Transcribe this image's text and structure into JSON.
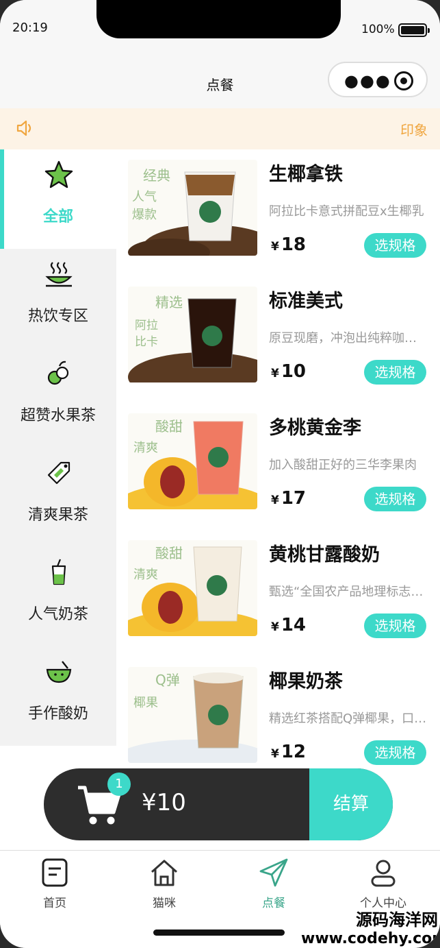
{
  "status_bar": {
    "time": "20:19",
    "battery": "100%"
  },
  "nav": {
    "title": "点餐",
    "capsule_menu_icon": "more-dots-icon",
    "capsule_close_icon": "target-icon"
  },
  "notice": {
    "icon": "speaker-icon",
    "text": "印象"
  },
  "sidebar": {
    "items": [
      {
        "label": "全部",
        "icon": "star-icon",
        "active": true
      },
      {
        "label": "热饮专区",
        "icon": "hot-drink-icon",
        "active": false
      },
      {
        "label": "超赞水果茶",
        "icon": "fruit-icon",
        "active": false
      },
      {
        "label": "清爽果茶",
        "icon": "tag-icon",
        "active": false
      },
      {
        "label": "人气奶茶",
        "icon": "milk-tea-icon",
        "active": false
      },
      {
        "label": "手作酸奶",
        "icon": "yogurt-bowl-icon",
        "active": false
      }
    ]
  },
  "products": [
    {
      "name": "生椰拿铁",
      "desc": "阿拉比卡意式拼配豆x生椰乳",
      "currency": "¥",
      "price": "18",
      "button": "选规格",
      "tag_text": "经典。 人气爆款",
      "cup_color": "#caa57a"
    },
    {
      "name": "标准美式",
      "desc": "原豆现磨，冲泡出纯粹咖啡香",
      "currency": "¥",
      "price": "10",
      "button": "选规格",
      "tag_text": "精选。 阿拉比卡豆",
      "cup_color": "#3a1d12"
    },
    {
      "name": "多桃黄金李",
      "desc": "加入酸甜正好的三华李果肉",
      "currency": "¥",
      "price": "17",
      "button": "选规格",
      "tag_text": "酸甜。 清爽",
      "cup_color": "#f07a62"
    },
    {
      "name": "黄桃甘露酸奶",
      "desc": "甄选“全国农产品地理标志”黄桃",
      "currency": "¥",
      "price": "14",
      "button": "选规格",
      "tag_text": "酸甜。 清爽",
      "cup_color": "#f4e9d6"
    },
    {
      "name": "椰果奶茶",
      "desc": "精选红茶搭配Q弹椰果，口感丰富",
      "currency": "¥",
      "price": "12",
      "button": "选规格",
      "tag_text": "Q弹。 椰果",
      "cup_color": "#c9a27c"
    }
  ],
  "cart": {
    "count": "1",
    "total": "¥10",
    "checkout": "结算"
  },
  "tabbar": {
    "items": [
      {
        "label": "首页",
        "icon": "document-icon",
        "active": false
      },
      {
        "label": "猫咪",
        "icon": "house-icon",
        "active": false
      },
      {
        "label": "点餐",
        "icon": "paper-plane-icon",
        "active": true
      },
      {
        "label": "个人中心",
        "icon": "user-icon",
        "active": false
      }
    ]
  },
  "watermark": {
    "line1": "源码海洋网",
    "line2": "www.codehy.com"
  },
  "colors": {
    "accent": "#3dd9c9",
    "notice_bg": "#fdf3e6",
    "notice_text": "#f0a640",
    "cart_bg": "#2d2d2d",
    "tab_active": "#3aa58a"
  }
}
